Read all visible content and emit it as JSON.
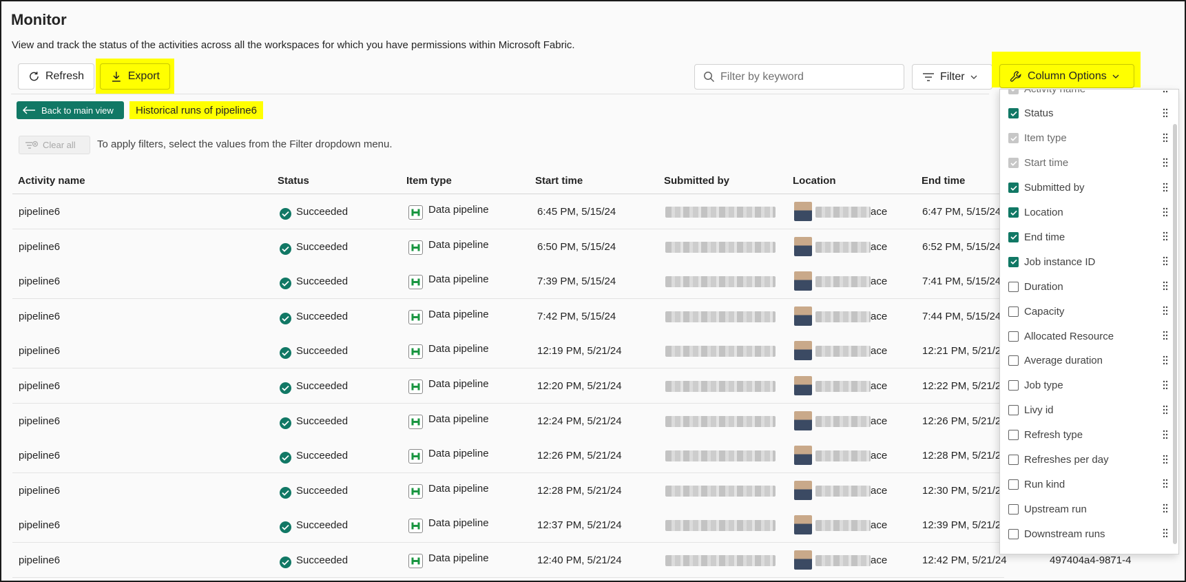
{
  "page": {
    "title": "Monitor",
    "subtitle": "View and track the status of the activities across all the workspaces for which you have permissions within Microsoft Fabric."
  },
  "toolbar": {
    "refresh_label": "Refresh",
    "export_label": "Export",
    "search_placeholder": "Filter by keyword",
    "filter_label": "Filter",
    "column_options_label": "Column Options"
  },
  "nav": {
    "back_label": "Back to main view",
    "history_label": "Historical runs of pipeline6"
  },
  "filters": {
    "clear_all_label": "Clear all",
    "hint": "To apply filters, select the values from the Filter dropdown menu."
  },
  "table": {
    "columns": [
      "Activity name",
      "Status",
      "Item type",
      "Start time",
      "Submitted by",
      "Location",
      "End time"
    ],
    "location_suffix": "ace",
    "rows": [
      {
        "name": "pipeline6",
        "status": "Succeeded",
        "item_type": "Data pipeline",
        "start": "6:45 PM, 5/15/24",
        "end": "6:47 PM, 5/15/24",
        "job_id": ""
      },
      {
        "name": "pipeline6",
        "status": "Succeeded",
        "item_type": "Data pipeline",
        "start": "6:50 PM, 5/15/24",
        "end": "6:52 PM, 5/15/24",
        "job_id": ""
      },
      {
        "name": "pipeline6",
        "status": "Succeeded",
        "item_type": "Data pipeline",
        "start": "7:39 PM, 5/15/24",
        "end": "7:41 PM, 5/15/24",
        "job_id": ""
      },
      {
        "name": "pipeline6",
        "status": "Succeeded",
        "item_type": "Data pipeline",
        "start": "7:42 PM, 5/15/24",
        "end": "7:44 PM, 5/15/24",
        "job_id": ""
      },
      {
        "name": "pipeline6",
        "status": "Succeeded",
        "item_type": "Data pipeline",
        "start": "12:19 PM, 5/21/24",
        "end": "12:21 PM, 5/21/24",
        "job_id": ""
      },
      {
        "name": "pipeline6",
        "status": "Succeeded",
        "item_type": "Data pipeline",
        "start": "12:20 PM, 5/21/24",
        "end": "12:22 PM, 5/21/24",
        "job_id": ""
      },
      {
        "name": "pipeline6",
        "status": "Succeeded",
        "item_type": "Data pipeline",
        "start": "12:24 PM, 5/21/24",
        "end": "12:26 PM, 5/21/24",
        "job_id": ""
      },
      {
        "name": "pipeline6",
        "status": "Succeeded",
        "item_type": "Data pipeline",
        "start": "12:26 PM, 5/21/24",
        "end": "12:28 PM, 5/21/24",
        "job_id": ""
      },
      {
        "name": "pipeline6",
        "status": "Succeeded",
        "item_type": "Data pipeline",
        "start": "12:28 PM, 5/21/24",
        "end": "12:30 PM, 5/21/24",
        "job_id": ""
      },
      {
        "name": "pipeline6",
        "status": "Succeeded",
        "item_type": "Data pipeline",
        "start": "12:37 PM, 5/21/24",
        "end": "12:39 PM, 5/21/24",
        "job_id": ""
      },
      {
        "name": "pipeline6",
        "status": "Succeeded",
        "item_type": "Data pipeline",
        "start": "12:40 PM, 5/21/24",
        "end": "12:42 PM, 5/21/24",
        "job_id": "497404a4-9871-4"
      }
    ]
  },
  "column_options": [
    {
      "label": "Activity name",
      "state": "disabled"
    },
    {
      "label": "Status",
      "state": "checked"
    },
    {
      "label": "Item type",
      "state": "disabled"
    },
    {
      "label": "Start time",
      "state": "disabled"
    },
    {
      "label": "Submitted by",
      "state": "checked"
    },
    {
      "label": "Location",
      "state": "checked"
    },
    {
      "label": "End time",
      "state": "checked"
    },
    {
      "label": "Job instance ID",
      "state": "checked"
    },
    {
      "label": "Duration",
      "state": "unchecked"
    },
    {
      "label": "Capacity",
      "state": "unchecked"
    },
    {
      "label": "Allocated Resource",
      "state": "unchecked"
    },
    {
      "label": "Average duration",
      "state": "unchecked"
    },
    {
      "label": "Job type",
      "state": "unchecked"
    },
    {
      "label": "Livy id",
      "state": "unchecked"
    },
    {
      "label": "Refresh type",
      "state": "unchecked"
    },
    {
      "label": "Refreshes per day",
      "state": "unchecked"
    },
    {
      "label": "Run kind",
      "state": "unchecked"
    },
    {
      "label": "Upstream run",
      "state": "unchecked"
    },
    {
      "label": "Downstream runs",
      "state": "unchecked"
    }
  ],
  "colors": {
    "accent": "#117865",
    "highlight": "#ffff00"
  }
}
